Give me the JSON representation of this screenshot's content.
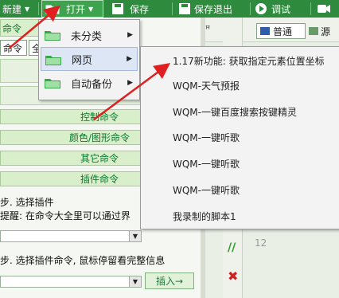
{
  "toolbar": {
    "new_label": "新建",
    "open_label": "打开",
    "save_label": "保存",
    "save_exit_label": "保存退出",
    "debug_label": "调试"
  },
  "left_panel": {
    "top_label": "命令",
    "tabs": [
      "命令",
      "全"
    ],
    "commands": [
      "控制命令",
      "颜色/图形命令",
      "其它命令",
      "插件命令"
    ],
    "step1": "步. 选择插件",
    "hint": "提醒: 在命令大全里可以通过界",
    "step2": "步. 选择插件命令, 鼠标停留看完整信息",
    "insert_label": "插入→"
  },
  "right_panel": {
    "normal_tab": "普通",
    "other_tab": "源",
    "line_number": "12",
    "pin": "ꟸ"
  },
  "open_menu": {
    "items": [
      "未分类",
      "网页",
      "自动备份"
    ]
  },
  "web_submenu": {
    "items": [
      "1.17新功能: 获取指定元素位置坐标",
      "WQM-天气预报",
      "WQM-一键百度搜索按键精灵",
      "WQM-一键听歌",
      "WQM-一键听歌",
      "WQM-一键听歌",
      "我录制的脚本1"
    ]
  },
  "colors": {
    "toolbar_green": "#2e8a3c",
    "annotation_red": "#e02020",
    "command_text": "#0a7a2e"
  }
}
